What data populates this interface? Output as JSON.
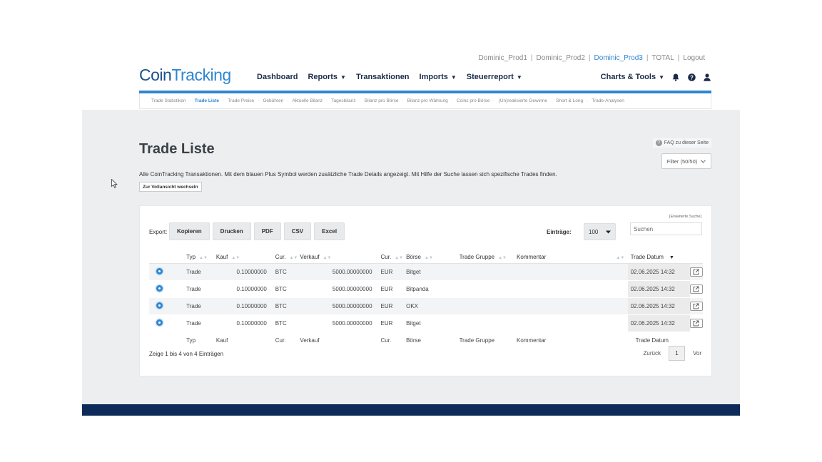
{
  "accounts": [
    "Dominic_Prod1",
    "Dominic_Prod2",
    "Dominic_Prod3",
    "TOTAL",
    "Logout"
  ],
  "active_account": "Dominic_Prod3",
  "logo": {
    "part1": "Coin",
    "part2": "Tracking"
  },
  "nav": {
    "dashboard": "Dashboard",
    "reports": "Reports",
    "transaktionen": "Transaktionen",
    "imports": "Imports",
    "steuerreport": "Steuerreport",
    "charts_tools": "Charts & Tools"
  },
  "subnav": [
    "Trade Statistiken",
    "Trade Liste",
    "Trade Preise",
    "Gebühren",
    "Aktuelle Bilanz",
    "Tagesbilanz",
    "Bilanz pro Börse",
    "Bilanz pro Währung",
    "Coins pro Börse",
    "(Un)realisierte Gewinne",
    "Short & Long",
    "Trade-Analysen"
  ],
  "subnav_active": "Trade Liste",
  "page": {
    "title": "Trade Liste",
    "faq": "FAQ zu dieser Seite",
    "filter": "Filter (50/50)",
    "description": "Alle CoinTracking Transaktionen. Mit dem blauen Plus Symbol werden zusätzliche Trade Details angezeigt. Mit Hilfe der Suche lassen sich spezifische Trades finden.",
    "switch_view": "Zur Vollansicht wechseln"
  },
  "table_controls": {
    "extended_search": "[Erweiterte Suche]",
    "export_label": "Export:",
    "export_buttons": [
      "Kopieren",
      "Drucken",
      "PDF",
      "CSV",
      "Excel"
    ],
    "entries_label": "Einträge:",
    "entries_value": "100",
    "search_placeholder": "Suchen"
  },
  "columns": {
    "typ": "Typ",
    "kauf": "Kauf",
    "cur1": "Cur.",
    "verkauf": "Verkauf",
    "cur2": "Cur.",
    "boerse": "Börse",
    "gruppe": "Trade Gruppe",
    "kommentar": "Kommentar",
    "datum": "Trade Datum"
  },
  "rows": [
    {
      "typ": "Trade",
      "kauf": "0.10000000",
      "cur1": "BTC",
      "verkauf": "5000.00000000",
      "cur2": "EUR",
      "boerse": "Bitget",
      "gruppe": "",
      "kommentar": "",
      "datum": "02.06.2025 14:32"
    },
    {
      "typ": "Trade",
      "kauf": "0.10000000",
      "cur1": "BTC",
      "verkauf": "5000.00000000",
      "cur2": "EUR",
      "boerse": "Bitpanda",
      "gruppe": "",
      "kommentar": "",
      "datum": "02.06.2025 14:32"
    },
    {
      "typ": "Trade",
      "kauf": "0.10000000",
      "cur1": "BTC",
      "verkauf": "5000.00000000",
      "cur2": "EUR",
      "boerse": "OKX",
      "gruppe": "",
      "kommentar": "",
      "datum": "02.06.2025 14:32"
    },
    {
      "typ": "Trade",
      "kauf": "0.10000000",
      "cur1": "BTC",
      "verkauf": "5000.00000000",
      "cur2": "EUR",
      "boerse": "Bitget",
      "gruppe": "",
      "kommentar": "",
      "datum": "02.06.2025 14:32"
    }
  ],
  "footer": {
    "info": "Zeige 1 bis 4 von 4 Einträgen",
    "prev": "Zurück",
    "page": "1",
    "next": "Vor"
  },
  "colors": {
    "brand_dark": "#1c4f8f",
    "brand_blue": "#2f86d0",
    "footer_band": "#0e2a58"
  }
}
